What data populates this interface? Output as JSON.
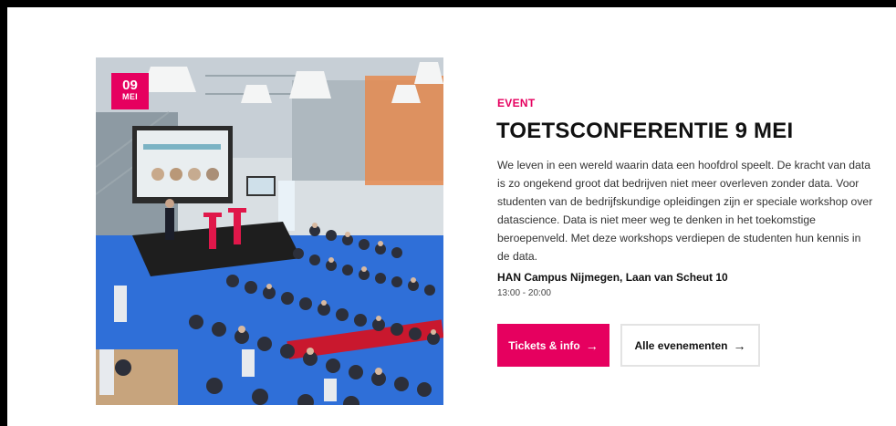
{
  "event": {
    "badge": {
      "day": "09",
      "month": "MEI"
    },
    "eyebrow": "EVENT",
    "title": "TOETSCONFERENTIE 9 MEI",
    "description": "We leven in een wereld waarin data een hoofdrol speelt. De kracht van data is zo ongekend groot dat bedrijven niet meer overleven zonder data. Voor studenten van de bedrijfskundige opleidingen zijn er speciale workshop over datascience. Data is niet meer weg te denken in het toekomstige beroepenveld. Met deze workshops verdiepen de studenten hun kennis in de data.",
    "location": "HAN Campus Nijmegen, Laan van Scheut 10",
    "time": "13:00 - 20:00",
    "photo_alt": "Conference audience in an atrium with a presenter on stage"
  },
  "buttons": {
    "tickets": {
      "label": "Tickets & info",
      "icon": "arrow-right-icon"
    },
    "all_events": {
      "label": "Alle evenementen",
      "icon": "arrow-right-icon"
    }
  },
  "colors": {
    "accent": "#e6005f",
    "text": "#111111",
    "stage_floor": "#2f6fd8",
    "backdrop": "#000000"
  }
}
